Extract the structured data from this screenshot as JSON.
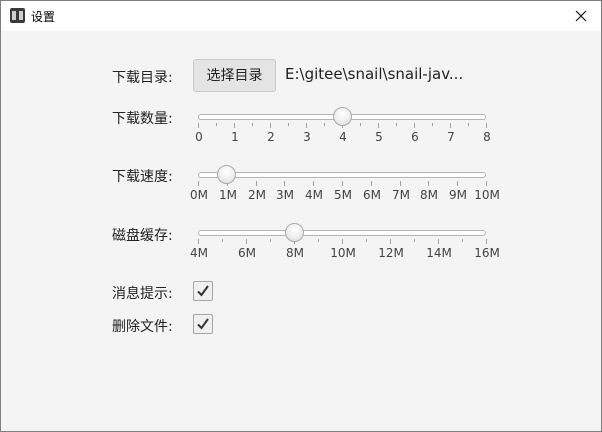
{
  "window": {
    "title": "设置",
    "icon": "app-icon",
    "close_icon": "close-icon"
  },
  "download_dir": {
    "label": "下载目录:",
    "button_label": "选择目录",
    "path": "E:\\gitee\\snail\\snail-jav..."
  },
  "sliders": [
    {
      "id": "download-count",
      "label": "下载数量:",
      "min": 0,
      "max": 8,
      "value": 4,
      "ticks": [
        "0",
        "1",
        "2",
        "3",
        "4",
        "5",
        "6",
        "7",
        "8"
      ],
      "minor_per_major": 1
    },
    {
      "id": "download-speed",
      "label": "下载速度:",
      "min": 0,
      "max": 10,
      "value": 1,
      "ticks": [
        "0M",
        "1M",
        "2M",
        "3M",
        "4M",
        "5M",
        "6M",
        "7M",
        "8M",
        "9M",
        "10M"
      ],
      "minor_per_major": 0
    },
    {
      "id": "disk-cache",
      "label": "磁盘缓存:",
      "min": 4,
      "max": 16,
      "value": 8,
      "ticks": [
        "4M",
        "6M",
        "8M",
        "10M",
        "12M",
        "14M",
        "16M"
      ],
      "minor_per_major": 1
    }
  ],
  "notify": {
    "label": "消息提示:",
    "checked": true
  },
  "delete_file": {
    "label": "删除文件:",
    "checked": true
  }
}
